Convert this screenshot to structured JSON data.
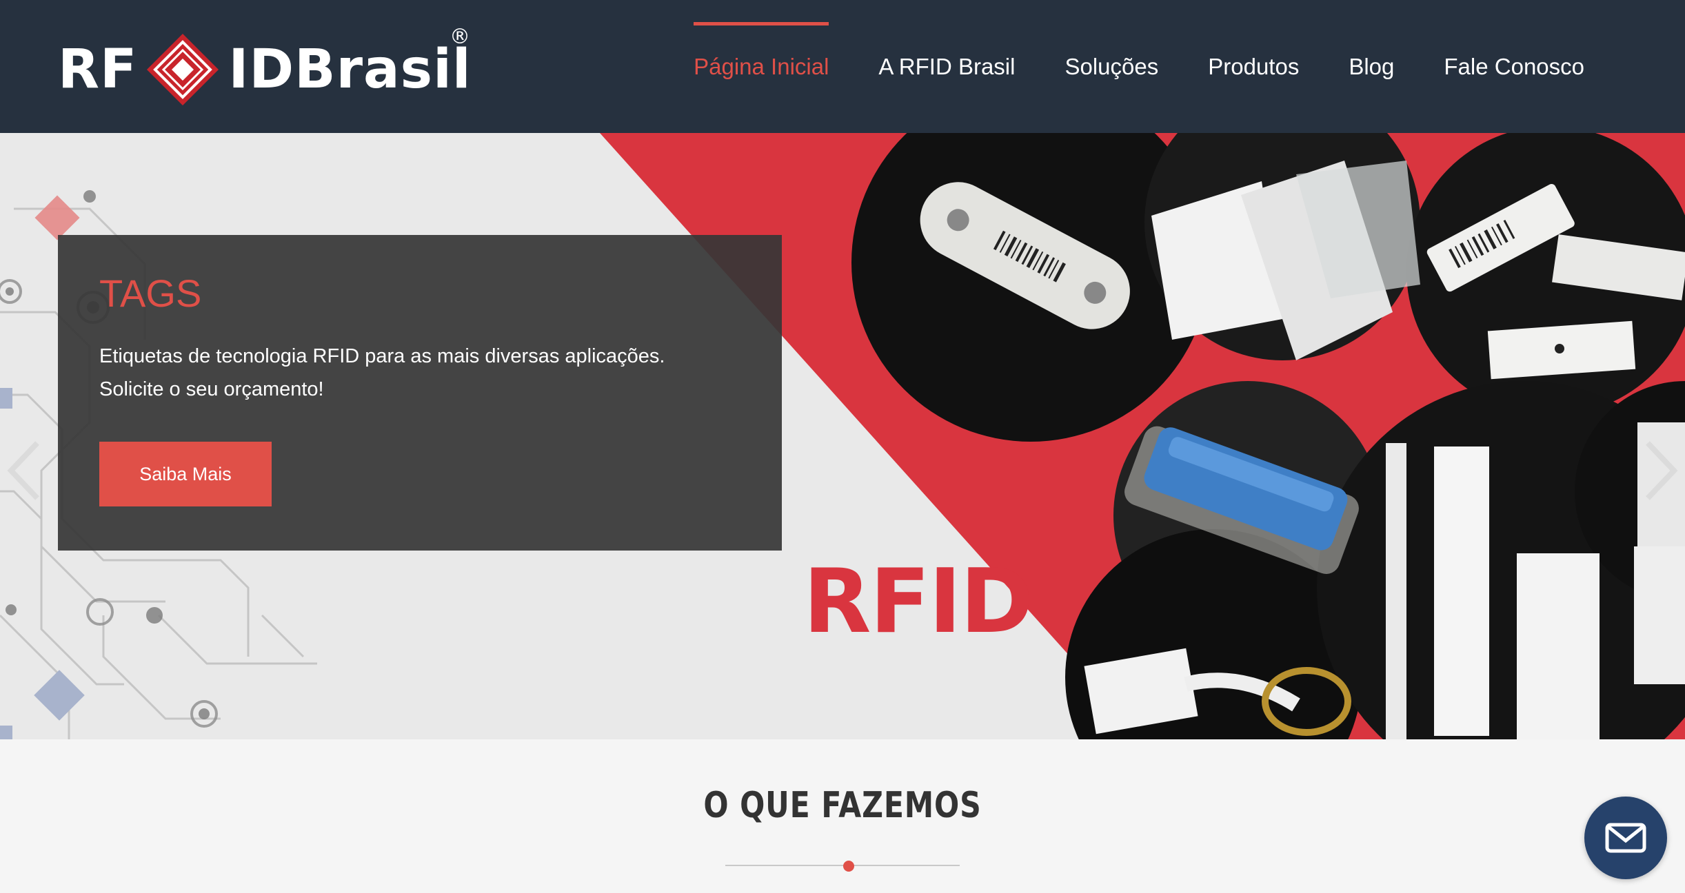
{
  "brand": {
    "logo_left": "RF",
    "logo_right": "IDBrasil",
    "registered_mark": "®",
    "accent_color": "#e05048",
    "header_color": "#26313f"
  },
  "nav": {
    "items": [
      {
        "label": "Página Inicial",
        "active": true
      },
      {
        "label": "A RFID Brasil",
        "active": false
      },
      {
        "label": "Soluções",
        "active": false
      },
      {
        "label": "Produtos",
        "active": false
      },
      {
        "label": "Blog",
        "active": false
      },
      {
        "label": "Fale Conosco",
        "active": false
      }
    ]
  },
  "hero": {
    "title": "TAGS",
    "text_line1": "Etiquetas de tecnologia RFID para as mais diversas aplicações.",
    "text_line2": "Solicite o seu orçamento!",
    "button_label": "Saiba Mais",
    "image_word": "RFID",
    "prev_icon": "chevron-left-icon",
    "next_icon": "chevron-right-icon"
  },
  "section": {
    "title": "O QUE FAZEMOS"
  },
  "floating": {
    "icon": "envelope-icon"
  }
}
